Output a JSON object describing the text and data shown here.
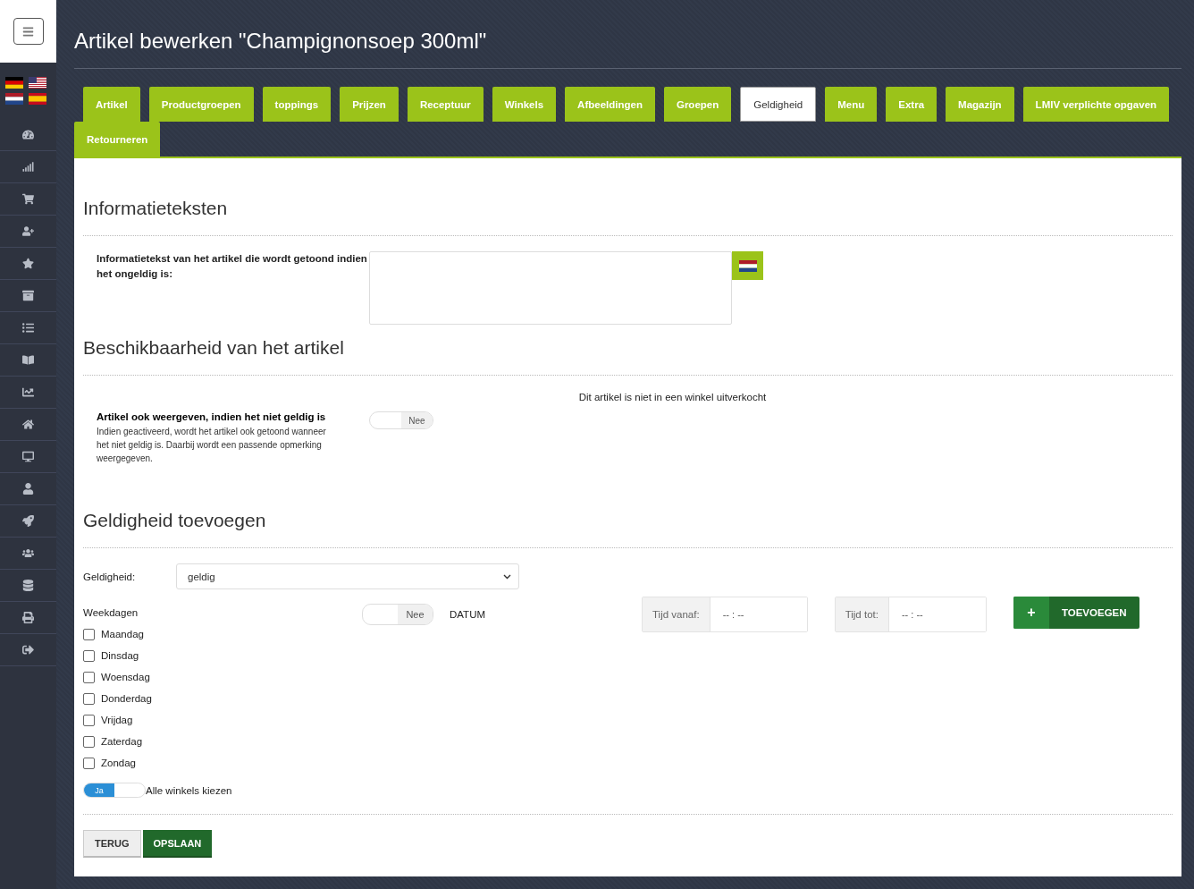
{
  "page_title": "Artikel bewerken \"Champignonsoep 300ml\"",
  "tabs": [
    {
      "label": "Artikel",
      "selected": false
    },
    {
      "label": "Productgroepen",
      "selected": false
    },
    {
      "label": "toppings",
      "selected": false
    },
    {
      "label": "Prijzen",
      "selected": false
    },
    {
      "label": "Receptuur",
      "selected": false
    },
    {
      "label": "Winkels",
      "selected": false
    },
    {
      "label": "Afbeeldingen",
      "selected": false
    },
    {
      "label": "Groepen",
      "selected": false
    },
    {
      "label": "Geldigheid",
      "selected": true
    },
    {
      "label": "Menu",
      "selected": false
    },
    {
      "label": "Extra",
      "selected": false
    },
    {
      "label": "Magazijn",
      "selected": false
    },
    {
      "label": "LMIV verplichte opgaven",
      "selected": false
    },
    {
      "label": "Retourneren",
      "selected": false
    }
  ],
  "info_section": {
    "heading": "Informatieteksten",
    "label": "Informatietekst van het artikel die wordt getoond indien het ongeldig is:"
  },
  "availability_section": {
    "heading": "Beschikbaarheid van het artikel",
    "notice": "Dit artikel is niet in een winkel uitverkocht",
    "label": "Artikel ook weergeven, indien het niet geldig is",
    "description": "Indien geactiveerd, wordt het artikel ook getoond wanneer het niet geldig is. Daarbij wordt een passende opmerking weergegeven.",
    "toggle": {
      "on": false,
      "label": "Nee"
    }
  },
  "validity_section": {
    "heading": "Geldigheid toevoegen",
    "select_label": "Geldigheid:",
    "select_value": "geldig",
    "weekdays_label": "Weekdagen",
    "weekdays": [
      {
        "label": "Maandag",
        "checked": false
      },
      {
        "label": "Dinsdag",
        "checked": false
      },
      {
        "label": "Woensdag",
        "checked": false
      },
      {
        "label": "Donderdag",
        "checked": false
      },
      {
        "label": "Vrijdag",
        "checked": false
      },
      {
        "label": "Zaterdag",
        "checked": false
      },
      {
        "label": "Zondag",
        "checked": false
      }
    ],
    "date_toggle": {
      "on": false,
      "label": "Nee"
    },
    "date_label": "DATUM",
    "time_from": {
      "label": "Tijd vanaf:",
      "placeholder": "-- : --"
    },
    "time_to": {
      "label": "Tijd tot:",
      "placeholder": "-- : --"
    },
    "add_button": {
      "icon": "+",
      "label": "TOEVOEGEN"
    },
    "stores_toggle": {
      "on": true,
      "label": "Ja"
    },
    "stores_label": "Alle winkels kiezen"
  },
  "buttons": [
    {
      "label": "TERUG",
      "kind": "secondary"
    },
    {
      "label": "OPSLAAN",
      "kind": "primary"
    }
  ]
}
